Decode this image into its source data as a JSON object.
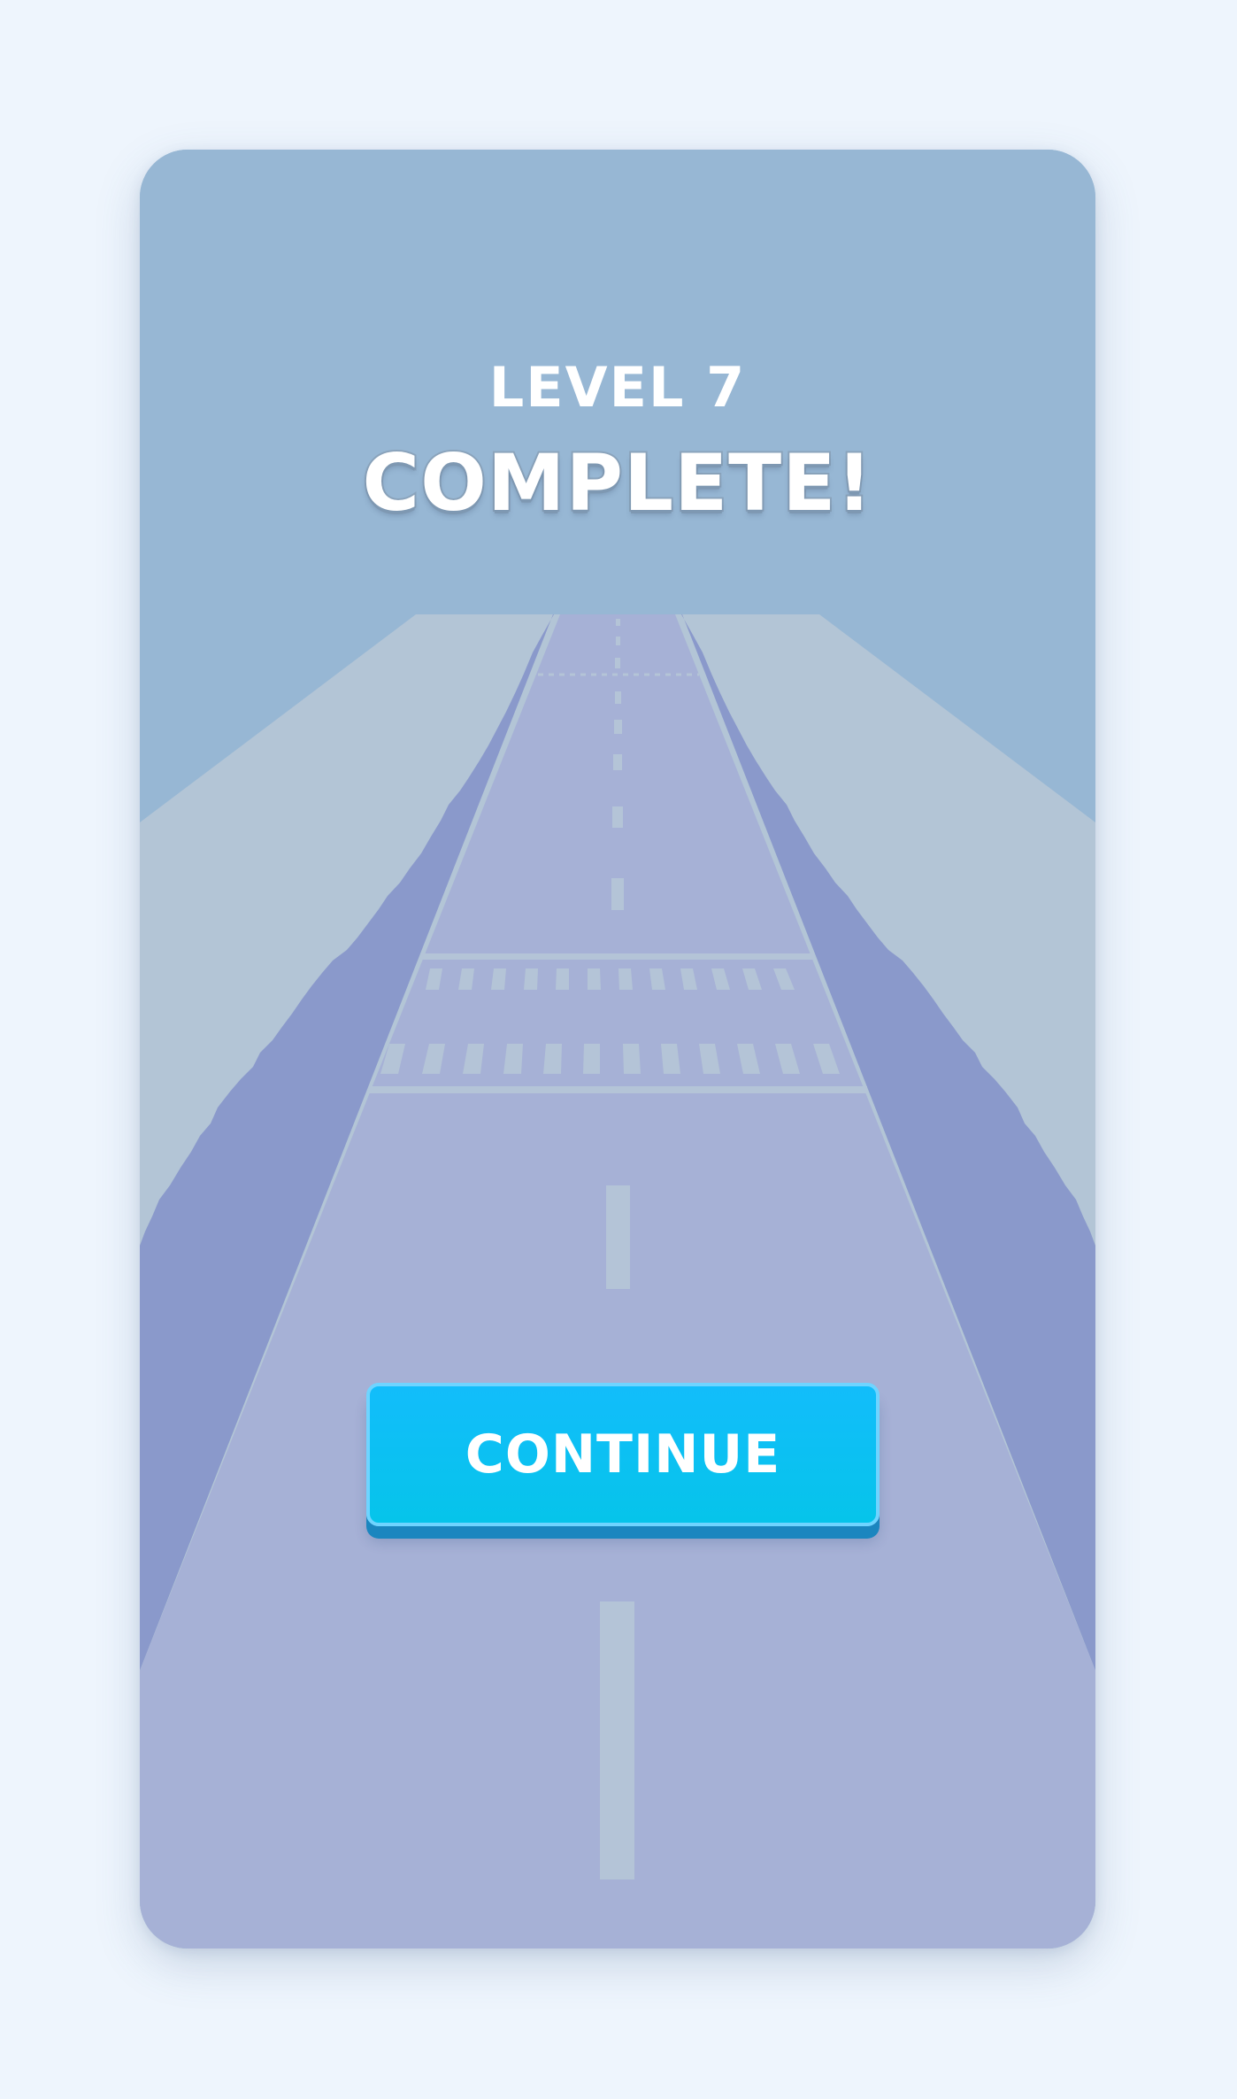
{
  "screen": {
    "level_label": "LEVEL 7",
    "title": "COMPLETE!"
  },
  "actions": {
    "continue_label": "CONTINUE"
  },
  "colors": {
    "page_background": "#eef5fd",
    "sky": "#97b7d4",
    "ground": "#b3c5d6",
    "road": "#a6b1d6",
    "road_edge": "#8a99cb",
    "lane_marking": "#b4c4d7",
    "button_top": "#12bdfb",
    "button_bottom": "#06c4ea",
    "button_shadow": "#1b86bf"
  }
}
